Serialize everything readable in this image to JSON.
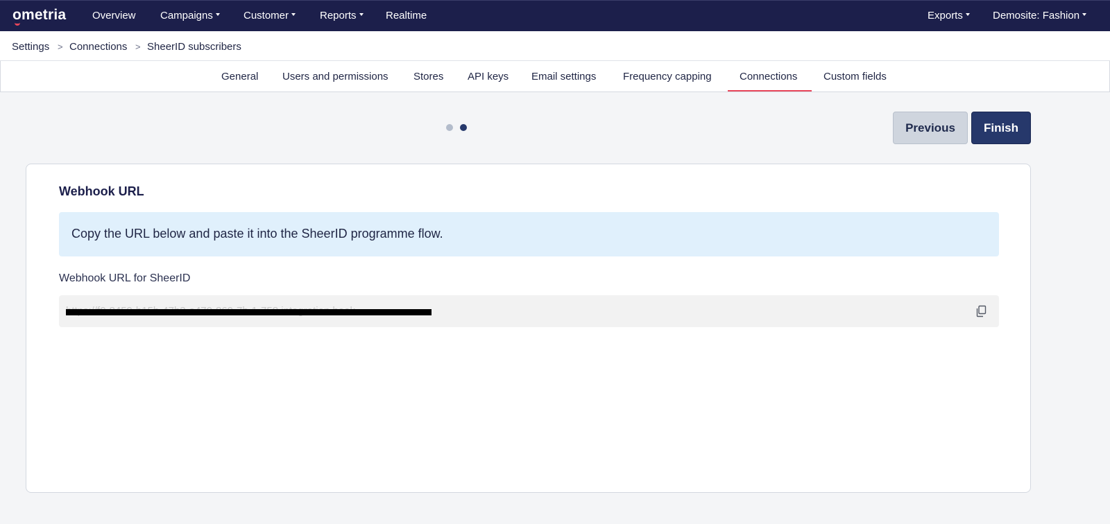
{
  "brand": {
    "logo": "ometria",
    "accent": "#e8465b",
    "nav_bg": "#1c1f4b",
    "primary": "#26386b"
  },
  "topnav": {
    "items": [
      {
        "label": "Overview",
        "dropdown": false
      },
      {
        "label": "Campaigns",
        "dropdown": true
      },
      {
        "label": "Customer",
        "dropdown": true
      },
      {
        "label": "Reports",
        "dropdown": true
      },
      {
        "label": "Realtime",
        "dropdown": false
      }
    ],
    "right": [
      {
        "label": "Exports",
        "dropdown": true
      },
      {
        "label": "Demosite: Fashion",
        "dropdown": true
      }
    ]
  },
  "breadcrumb": {
    "items": [
      "Settings",
      "Connections",
      "SheerID subscribers"
    ],
    "separator": ">"
  },
  "tabs": {
    "items": [
      "General",
      "Users and permissions",
      "Stores",
      "API keys",
      "Email settings",
      "Frequency capping",
      "Connections",
      "Custom fields"
    ],
    "active": "Connections"
  },
  "wizard": {
    "steps_total": 2,
    "current_step": 2,
    "previous_label": "Previous",
    "finish_label": "Finish"
  },
  "card": {
    "title": "Webhook URL",
    "info": "Copy the URL below and paste it into the SheerID programme flow.",
    "field_label": "Webhook URL for SheerID",
    "field_value": "https://f0-8459-b15b-47b3-a470-869-7b-1-758.integration.hook",
    "field_value_redacted": true,
    "copy_icon": "copy-icon"
  }
}
